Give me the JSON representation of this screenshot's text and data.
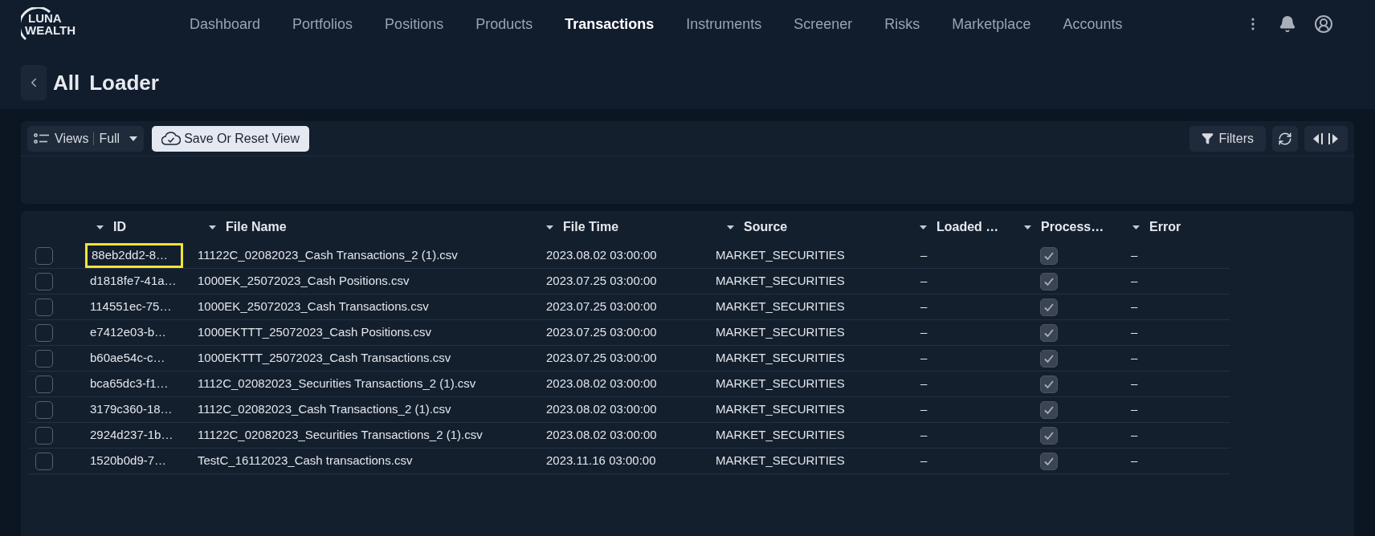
{
  "brand": {
    "line_1": "LUNA",
    "line_2": "WEALTH"
  },
  "nav": [
    {
      "label": "Dashboard",
      "selected": false
    },
    {
      "label": "Portfolios",
      "selected": false
    },
    {
      "label": "Positions",
      "selected": false
    },
    {
      "label": "Products",
      "selected": false
    },
    {
      "label": "Transactions",
      "selected": true
    },
    {
      "label": "Instruments",
      "selected": false
    },
    {
      "label": "Screener",
      "selected": false
    },
    {
      "label": "Risks",
      "selected": false
    },
    {
      "label": "Marketplace",
      "selected": false
    },
    {
      "label": "Accounts",
      "selected": false
    }
  ],
  "page_title": {
    "part_1": "All",
    "part_2": "Loader"
  },
  "toolbar": {
    "views_label": "Views",
    "view_name": "Full",
    "save_button": "Save Or Reset View",
    "filters_button": "Filters"
  },
  "table": {
    "columns": [
      "ID",
      "File Name",
      "File Time",
      "Source",
      "Loaded …",
      "Process…",
      "Error"
    ],
    "rows": [
      {
        "id": "88eb2dd2-8…",
        "file_name": "11122C_02082023_Cash Transactions_2 (1).csv",
        "file_time": "2023.08.02 03:00:00",
        "source": "MARKET_SECURITIES",
        "loaded": "–",
        "processed": true,
        "error": "–",
        "checked": false,
        "focused": true
      },
      {
        "id": "d1818fe7-41a…",
        "file_name": "1000EK_25072023_Cash Positions.csv",
        "file_time": "2023.07.25 03:00:00",
        "source": "MARKET_SECURITIES",
        "loaded": "–",
        "processed": true,
        "error": "–",
        "checked": false,
        "focused": false
      },
      {
        "id": "114551ec-75…",
        "file_name": "1000EK_25072023_Cash Transactions.csv",
        "file_time": "2023.07.25 03:00:00",
        "source": "MARKET_SECURITIES",
        "loaded": "–",
        "processed": true,
        "error": "–",
        "checked": false,
        "focused": false
      },
      {
        "id": "e7412e03-b…",
        "file_name": "1000EKTTT_25072023_Cash Positions.csv",
        "file_time": "2023.07.25 03:00:00",
        "source": "MARKET_SECURITIES",
        "loaded": "–",
        "processed": true,
        "error": "–",
        "checked": false,
        "focused": false
      },
      {
        "id": "b60ae54c-c…",
        "file_name": "1000EKTTT_25072023_Cash Transactions.csv",
        "file_time": "2023.07.25 03:00:00",
        "source": "MARKET_SECURITIES",
        "loaded": "–",
        "processed": true,
        "error": "–",
        "checked": false,
        "focused": false
      },
      {
        "id": "bca65dc3-f1…",
        "file_name": "1112C_02082023_Securities Transactions_2 (1).csv",
        "file_time": "2023.08.02 03:00:00",
        "source": "MARKET_SECURITIES",
        "loaded": "–",
        "processed": true,
        "error": "–",
        "checked": false,
        "focused": false
      },
      {
        "id": "3179c360-18…",
        "file_name": "1112C_02082023_Cash Transactions_2 (1).csv",
        "file_time": "2023.08.02 03:00:00",
        "source": "MARKET_SECURITIES",
        "loaded": "–",
        "processed": true,
        "error": "–",
        "checked": false,
        "focused": false
      },
      {
        "id": "2924d237-1b…",
        "file_name": "11122C_02082023_Securities Transactions_2 (1).csv",
        "file_time": "2023.08.02 03:00:00",
        "source": "MARKET_SECURITIES",
        "loaded": "–",
        "processed": true,
        "error": "–",
        "checked": false,
        "focused": false
      },
      {
        "id": "1520b0d9-7…",
        "file_name": "TestC_16112023_Cash transactions.csv",
        "file_time": "2023.11.16 03:00:00",
        "source": "MARKET_SECURITIES",
        "loaded": "–",
        "processed": true,
        "error": "–",
        "checked": false,
        "focused": false
      }
    ]
  }
}
